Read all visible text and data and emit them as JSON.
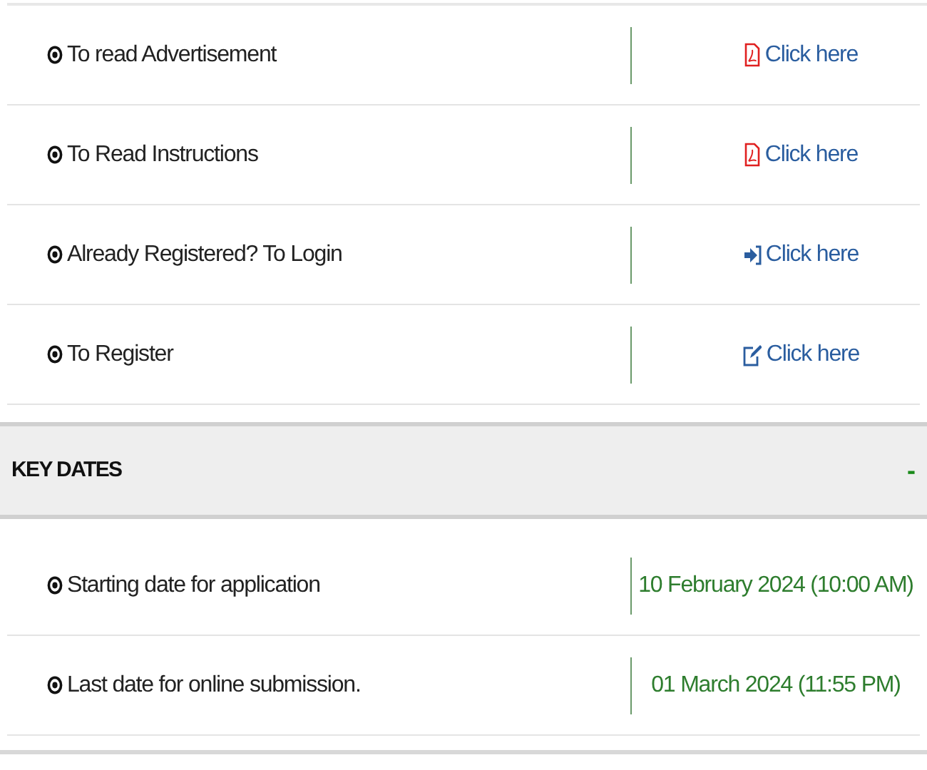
{
  "links": [
    {
      "label": "To read Advertisement",
      "link": "Click here",
      "kind": "pdf"
    },
    {
      "label": "To Read Instructions",
      "link": "Click here",
      "kind": "pdf"
    },
    {
      "label": "Already Registered? To Login",
      "link": "Click here",
      "kind": "login"
    },
    {
      "label": "To Register",
      "link": "Click here",
      "kind": "edit"
    }
  ],
  "key_dates": {
    "title": "KEY DATES",
    "toggle": "-",
    "expanded": true,
    "rows": [
      {
        "label": "Starting date for application",
        "date": "10 February 2024 (10:00 AM)"
      },
      {
        "label": "Last date for online submission.",
        "date": "01 March 2024 (11:55 PM)"
      }
    ]
  }
}
